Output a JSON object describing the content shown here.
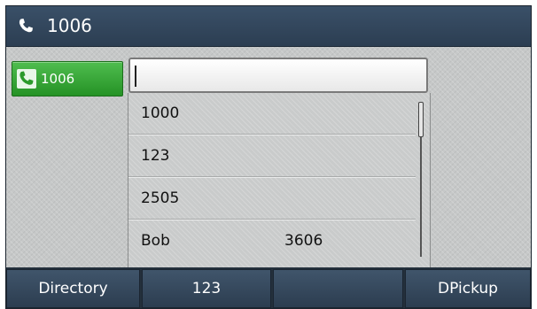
{
  "titlebar": {
    "icon": "phone-handset-icon",
    "title": "1006"
  },
  "line_key": {
    "icon": "phone-handset-icon",
    "label": "1006",
    "color": "#2f9e2f"
  },
  "dial_input": {
    "value": ""
  },
  "suggestions": [
    {
      "name": "1000",
      "number": ""
    },
    {
      "name": "123",
      "number": ""
    },
    {
      "name": "2505",
      "number": ""
    },
    {
      "name": "Bob",
      "number": "3606"
    }
  ],
  "softkeys": [
    {
      "label": "Directory"
    },
    {
      "label": "123"
    },
    {
      "label": ""
    },
    {
      "label": "DPickup"
    }
  ]
}
